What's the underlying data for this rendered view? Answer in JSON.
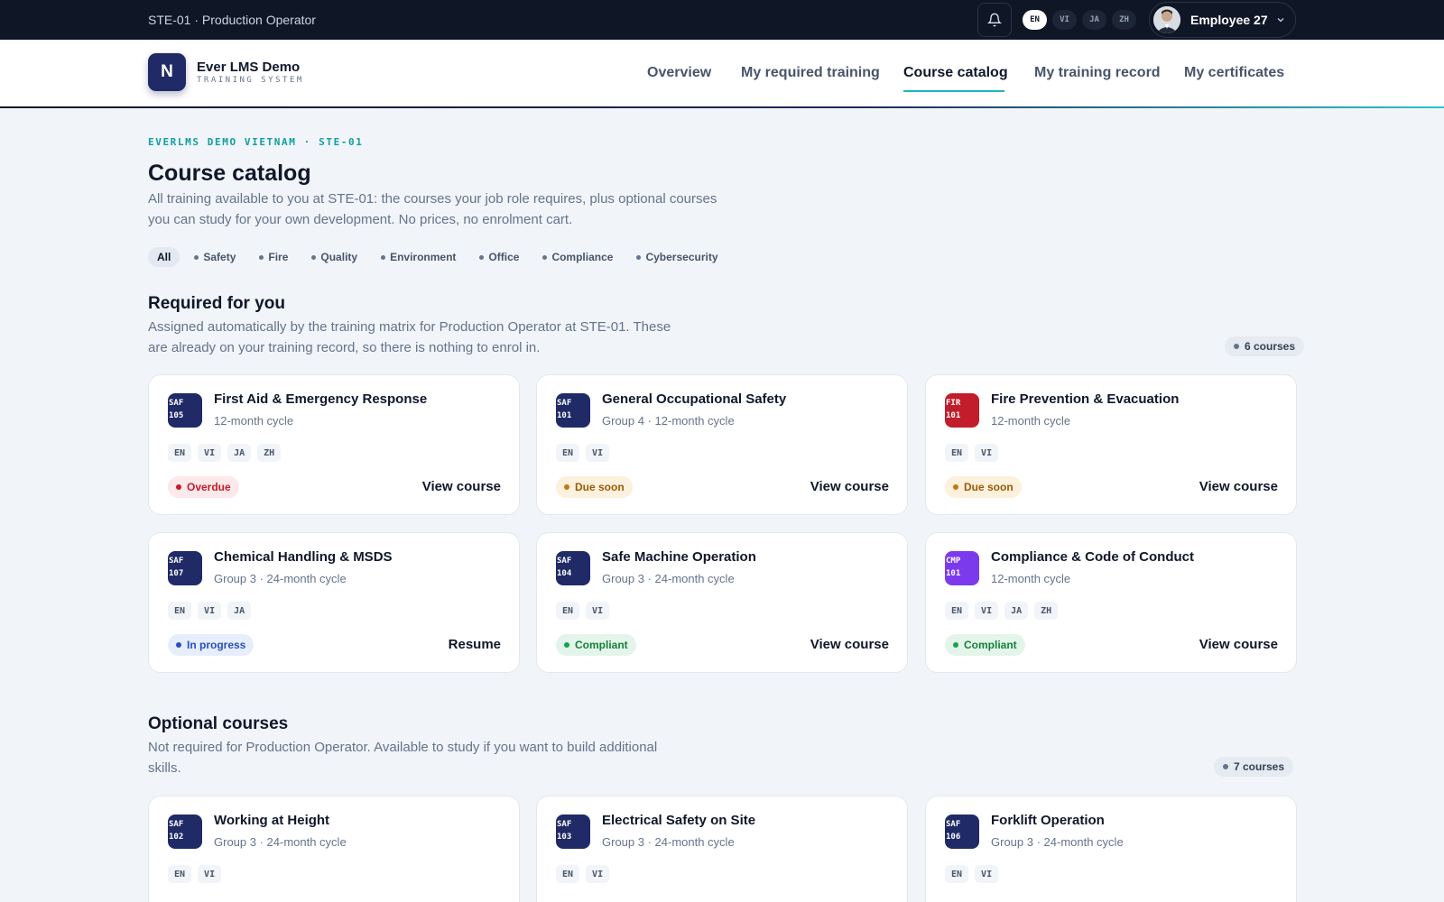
{
  "topbar": {
    "context": "STE-01 · Production Operator",
    "languages": [
      "EN",
      "VI",
      "JA",
      "ZH"
    ],
    "active_language": "EN",
    "user": "Employee 27"
  },
  "header": {
    "logo_letter": "N",
    "brand": "Ever LMS Demo",
    "brand_sub": "TRAINING SYSTEM",
    "nav": [
      "Overview",
      "My required training",
      "Course catalog",
      "My training record",
      "My certificates"
    ],
    "active_nav": "Course catalog"
  },
  "page": {
    "eyebrow": "EVERLMS DEMO VIETNAM · STE-01",
    "title": "Course catalog",
    "description": "All training available to you at STE-01: the courses your job role requires, plus optional courses you can study for your own development. No prices, no enrolment cart.",
    "filters": [
      "All",
      "Safety",
      "Fire",
      "Quality",
      "Environment",
      "Office",
      "Compliance",
      "Cybersecurity"
    ],
    "active_filter": "All"
  },
  "required": {
    "heading": "Required for you",
    "description": "Assigned automatically by the training matrix for Production Operator at STE-01. These are already on your training record, so there is nothing to enrol in.",
    "count": "6 courses",
    "courses": [
      {
        "code1": "SAF",
        "code2": "105",
        "color": "#1f2a66",
        "title": "First Aid & Emergency Response",
        "meta": "12-month cycle",
        "langs": [
          "EN",
          "VI",
          "JA",
          "ZH"
        ],
        "status": "Overdue",
        "status_kind": "overdue",
        "action": "View course"
      },
      {
        "code1": "SAF",
        "code2": "101",
        "color": "#1f2a66",
        "title": "General Occupational Safety",
        "meta": "Group 4 · 12-month cycle",
        "langs": [
          "EN",
          "VI"
        ],
        "status": "Due soon",
        "status_kind": "duesoon",
        "action": "View course"
      },
      {
        "code1": "FIR",
        "code2": "101",
        "color": "#c21d2a",
        "title": "Fire Prevention & Evacuation",
        "meta": "12-month cycle",
        "langs": [
          "EN",
          "VI"
        ],
        "status": "Due soon",
        "status_kind": "duesoon",
        "action": "View course"
      },
      {
        "code1": "SAF",
        "code2": "107",
        "color": "#1f2a66",
        "title": "Chemical Handling & MSDS",
        "meta": "Group 3 · 24-month cycle",
        "langs": [
          "EN",
          "VI",
          "JA"
        ],
        "status": "In progress",
        "status_kind": "inprogress",
        "action": "Resume"
      },
      {
        "code1": "SAF",
        "code2": "104",
        "color": "#1f2a66",
        "title": "Safe Machine Operation",
        "meta": "Group 3 · 24-month cycle",
        "langs": [
          "EN",
          "VI"
        ],
        "status": "Compliant",
        "status_kind": "compliant",
        "action": "View course"
      },
      {
        "code1": "CMP",
        "code2": "101",
        "color": "#7c3aed",
        "title": "Compliance & Code of Conduct",
        "meta": "12-month cycle",
        "langs": [
          "EN",
          "VI",
          "JA",
          "ZH"
        ],
        "status": "Compliant",
        "status_kind": "compliant",
        "action": "View course"
      }
    ]
  },
  "optional": {
    "heading": "Optional courses",
    "description": "Not required for Production Operator. Available to study if you want to build additional skills.",
    "count": "7 courses",
    "courses": [
      {
        "code1": "SAF",
        "code2": "102",
        "color": "#1f2a66",
        "title": "Working at Height",
        "meta": "Group 3 · 24-month cycle",
        "langs": [
          "EN",
          "VI"
        ]
      },
      {
        "code1": "SAF",
        "code2": "103",
        "color": "#1f2a66",
        "title": "Electrical Safety on Site",
        "meta": "Group 3 · 24-month cycle",
        "langs": [
          "EN",
          "VI"
        ]
      },
      {
        "code1": "SAF",
        "code2": "106",
        "color": "#1f2a66",
        "title": "Forklift Operation",
        "meta": "Group 3 · 24-month cycle",
        "langs": [
          "EN",
          "VI"
        ]
      }
    ]
  }
}
